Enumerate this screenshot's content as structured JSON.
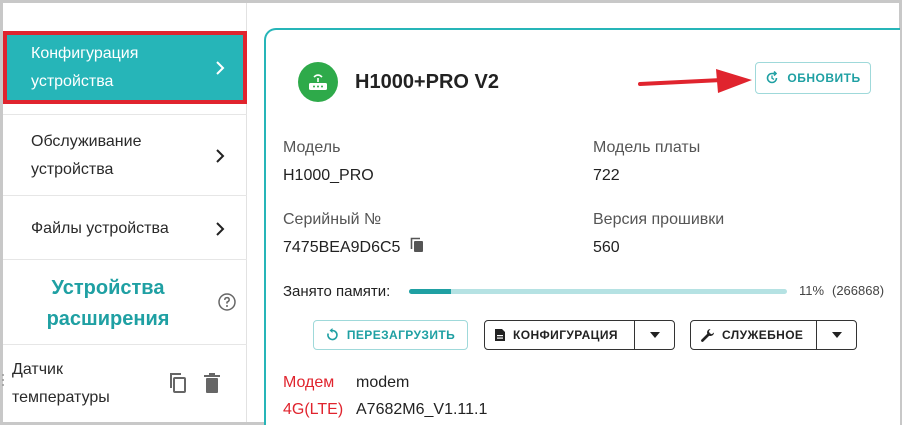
{
  "sidebar": {
    "items": [
      {
        "label": "Конфигурация устройства",
        "active": true
      },
      {
        "label": "Обслуживание устройства",
        "active": false
      },
      {
        "label": "Файлы устройства",
        "active": false
      }
    ],
    "extensions_title": "Устройства расширения",
    "sensor_label": "Датчик температуры"
  },
  "device": {
    "name": "H1000+PRO V2",
    "refresh_label": "ОБНОВИТЬ",
    "fields": {
      "model_label": "Модель",
      "model_value": "H1000_PRO",
      "board_label": "Модель платы",
      "board_value": "722",
      "serial_label": "Серийный №",
      "serial_value": "7475BEA9D6C5",
      "firmware_label": "Версия прошивки",
      "firmware_value": "560"
    },
    "memory": {
      "label": "Занято памяти:",
      "percent_text": "11%",
      "count_text": "(266868)",
      "fraction": 0.11
    },
    "buttons": {
      "reboot": "ПЕРЕЗАГРУЗИТЬ",
      "config": "КОНФИГУРАЦИЯ",
      "service": "СЛУЖЕБНОЕ"
    },
    "info": [
      {
        "key": "Модем",
        "value": "modem"
      },
      {
        "key": "4G(LTE)",
        "value": "A7682M6_V1.11.1"
      }
    ]
  },
  "colors": {
    "accent": "#26b5b8",
    "highlight": "#e0242e",
    "device_icon_bg": "#2eaa4a"
  },
  "icons": [
    "chevron-right-icon",
    "help-icon",
    "copy-icon",
    "trash-icon",
    "router-icon",
    "refresh-icon",
    "restart-icon",
    "document-icon",
    "wrench-icon",
    "caret-down-icon",
    "arrow-icon"
  ]
}
